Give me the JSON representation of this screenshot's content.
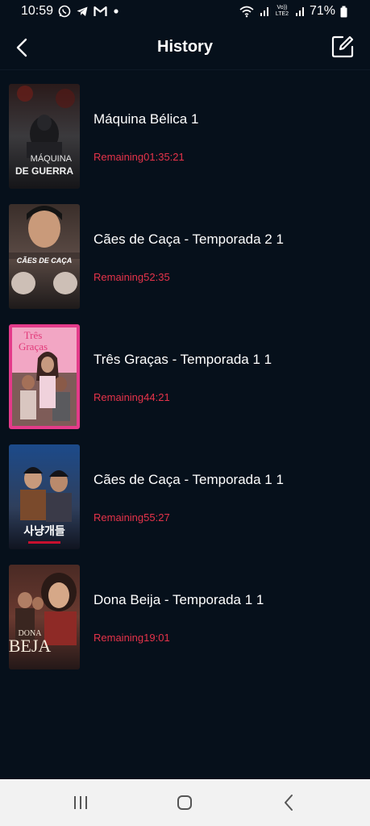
{
  "status_bar": {
    "time": "10:59",
    "volte_line1": "Vo))",
    "volte_line2": "LTE2",
    "battery": "71%",
    "icons": [
      "whatsapp-icon",
      "telegram-icon",
      "gmail-icon",
      "dot-icon",
      "wifi-icon",
      "signal-icon",
      "battery-icon"
    ]
  },
  "header": {
    "title": "History",
    "back_icon": "chevron-left-icon",
    "edit_icon": "edit-icon"
  },
  "history": [
    {
      "title": "Máquina Bélica 1",
      "remaining": "Remaining01:35:21",
      "poster_text_1": "MÁQUINA",
      "poster_text_2": "DE GUERRA"
    },
    {
      "title": "Cães de Caça - Temporada 2 1",
      "remaining": "Remaining52:35",
      "poster_text_1": "CÃES DE CAÇA"
    },
    {
      "title": "Três Graças - Temporada 1 1",
      "remaining": "Remaining44:21",
      "poster_text_1": "Três",
      "poster_text_2": "Graças"
    },
    {
      "title": "Cães de Caça - Temporada 1 1",
      "remaining": "Remaining55:27",
      "poster_text_1": "사냥개들"
    },
    {
      "title": "Dona Beija - Temporada 1 1",
      "remaining": "Remaining19:01",
      "poster_text_1": "DONA",
      "poster_text_2": "BEJA"
    }
  ],
  "colors": {
    "background": "#06101b",
    "remaining_text": "#e6334a",
    "nav_bar": "#f2f2f2"
  },
  "nav_bar": {
    "icons": [
      "recent-apps-icon",
      "home-icon",
      "back-icon"
    ]
  }
}
